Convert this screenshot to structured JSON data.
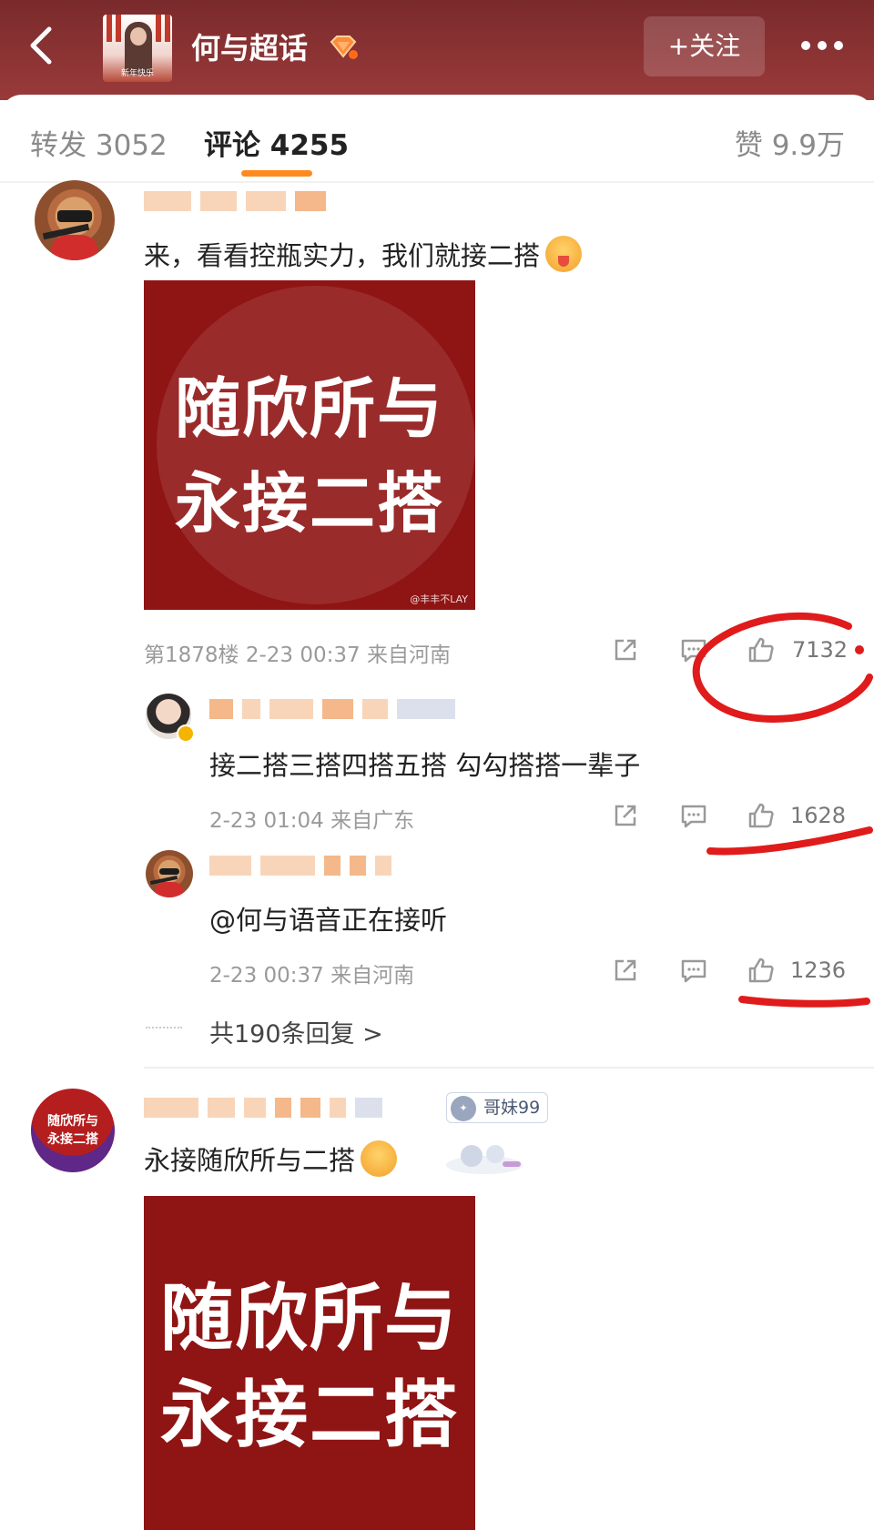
{
  "header": {
    "topic_title": "何与超话",
    "topic_thumb_caption": "新年快乐",
    "follow_label": "+关注"
  },
  "tabs": {
    "repost": "转发 3052",
    "comment": "评论 4255",
    "like": "赞 9.9万"
  },
  "comments": [
    {
      "text": "来，看看控瓶实力，我们就接二搭",
      "image_lines": [
        "随欣所与",
        "永接二搭"
      ],
      "image_watermark": "@丰丰不LAY",
      "meta": "第1878楼 2-23 00:37 来自河南",
      "likes": "7132",
      "replies": [
        {
          "text": "接二搭三搭四搭五搭 勾勾搭搭一辈子",
          "meta": "2-23 01:04 来自广东",
          "likes": "1628"
        },
        {
          "text": "@何与语音正在接听",
          "meta": "2-23 00:37 来自河南",
          "likes": "1236"
        }
      ],
      "more_replies": "共190条回复 >"
    },
    {
      "avatar_lines": [
        "随欣所与",
        "永接二搭"
      ],
      "tag": "哥妹99",
      "text": "永接随欣所与二搭",
      "image_lines": [
        "随欣所与",
        "永接二搭"
      ]
    }
  ],
  "colors": {
    "header_bg": "#8a3232",
    "tab_accent": "#ff8a1f",
    "image_bg": "#8f1414",
    "annotation_red": "#e01b1b"
  }
}
